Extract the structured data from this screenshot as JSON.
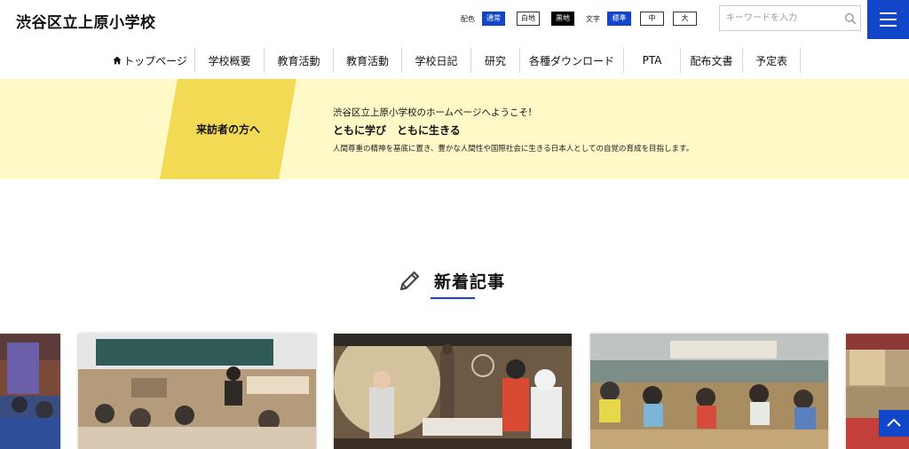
{
  "header": {
    "site_title": "渋谷区立上原小学校",
    "color_label": "配色",
    "color_options": [
      "通常",
      "白地",
      "黒地"
    ],
    "text_label": "文字",
    "text_options": [
      "標準",
      "中",
      "大"
    ],
    "search_placeholder": "キーワードを入力",
    "search_icon": "magnifier-icon",
    "menu_icon": "hamburger-icon"
  },
  "nav": {
    "items": [
      "トップページ",
      "学校概要",
      "教育活動",
      "教育活動",
      "学校日記",
      "研究",
      "各種ダウンロード",
      "PTA",
      "配布文書",
      "予定表"
    ],
    "home_icon": "home-icon"
  },
  "band": {
    "visitor_label": "来訪者の方へ",
    "welcome": "渋谷区立上原小学校のホームページへようこそ!",
    "motto": "ともに学び　ともに生きる",
    "goal": "人間尊重の精神を基底に置き、豊かな人間性や国際社会に生きる日本人としての自覚の育成を目指します。"
  },
  "section": {
    "title": "新着記事",
    "icon": "pencil-icon"
  },
  "colors": {
    "accent": "#1246c9",
    "band_bg": "#fff8c7",
    "visitor_bg": "#f3da55"
  }
}
